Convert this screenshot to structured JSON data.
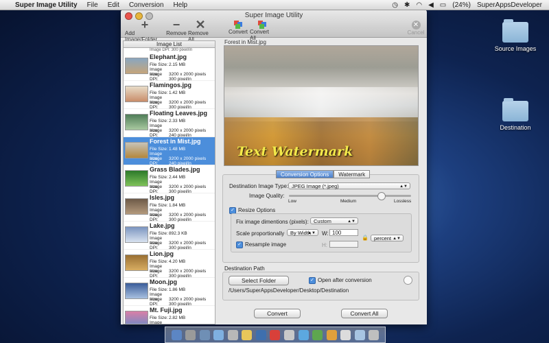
{
  "menubar": {
    "app_name": "Super Image Utility",
    "menus": [
      "File",
      "Edit",
      "Conversion",
      "Help"
    ],
    "battery": "(24%)",
    "user": "SuperAppsDeveloper"
  },
  "desktop": {
    "icons": [
      {
        "label": "Source Images"
      },
      {
        "label": "Destination"
      }
    ]
  },
  "window": {
    "title": "Super Image Utility",
    "toolbar": {
      "add": "Add Image/Folder",
      "remove": "Remove",
      "remove_all": "Remove All",
      "convert": "Convert",
      "convert_all": "Convert All",
      "cancel": "Cancel"
    },
    "image_list": {
      "header": "Image List",
      "partial_row": "Image DPI:   300 pixel/in",
      "labels": {
        "size": "File Size:",
        "dims": "Image size:",
        "dpi": "Image DPI:"
      },
      "items": [
        {
          "name": "Elephant.jpg",
          "size": "2.15 MB",
          "dims": "3200 x 2000 pixels",
          "dpi": "300 pixel/in",
          "colors": [
            "#8aa6c0",
            "#c5a57a"
          ]
        },
        {
          "name": "Flamingos.jpg",
          "size": "1.42 MB",
          "dims": "3200 x 2000 pixels",
          "dpi": "300 pixel/in",
          "colors": [
            "#e8dcc8",
            "#c98d6a"
          ]
        },
        {
          "name": "Floating Leaves.jpg",
          "size": "2.33 MB",
          "dims": "3200 x 2000 pixels",
          "dpi": "240 pixel/in",
          "colors": [
            "#4f7d58",
            "#a9c9a0"
          ]
        },
        {
          "name": "Forest in Mist.jpg",
          "size": "1.48 MB",
          "dims": "3200 x 2000 pixels",
          "dpi": "240 pixel/in",
          "colors": [
            "#c7c3b8",
            "#b4873d"
          ]
        },
        {
          "name": "Grass Blades.jpg",
          "size": "2.44 MB",
          "dims": "3200 x 2000 pixels",
          "dpi": "300 pixel/in",
          "colors": [
            "#2d7a2a",
            "#7fc25a"
          ]
        },
        {
          "name": "Isles.jpg",
          "size": "1.84 MB",
          "dims": "3200 x 2000 pixels",
          "dpi": "300 pixel/in",
          "colors": [
            "#6d5a48",
            "#b49a7d"
          ]
        },
        {
          "name": "Lake.jpg",
          "size": "892.3 KB",
          "dims": "3200 x 2000 pixels",
          "dpi": "300 pixel/in",
          "colors": [
            "#7b95c0",
            "#d8e2ef"
          ]
        },
        {
          "name": "Lion.jpg",
          "size": "4.20 MB",
          "dims": "3200 x 2000 pixels",
          "dpi": "300 pixel/in",
          "colors": [
            "#9a7033",
            "#d8ad62"
          ]
        },
        {
          "name": "Moon.jpg",
          "size": "1.86 MB",
          "dims": "3200 x 2000 pixels",
          "dpi": "300 pixel/in",
          "colors": [
            "#3a5d9a",
            "#a8c0e0"
          ]
        },
        {
          "name": "Mt. Fuji.jpg",
          "size": "2.82 MB",
          "dims": "3200 x 2000 pixels",
          "dpi": "72 pixel/in",
          "colors": [
            "#d97ea6",
            "#6e8bc7"
          ]
        }
      ],
      "selected_index": 3
    },
    "preview": {
      "caption": "Forest in Mist.jpg",
      "watermark_text": "Text Watermark"
    },
    "tabs": [
      "Conversion Options",
      "Watermark"
    ],
    "options": {
      "dest_type_label": "Destination Image Type:",
      "dest_type_value": "JPEG Image (*.jpeg)",
      "quality_label": "Image Quality:",
      "quality_low": "Low",
      "quality_medium": "Medium",
      "quality_lossless": "Lossless",
      "quality_level": 0.75,
      "resize_label": "Resize Options",
      "fix_label": "Fix image dimentions (pixels):",
      "fix_value": "Custom",
      "scale_label": "Scale proportionally",
      "scale_value": "By Width",
      "w_label": "W:",
      "w_value": "100",
      "h_label": "H:",
      "h_value": "",
      "unit_value": "percent",
      "resample_label": "Resample image"
    },
    "destination": {
      "section_label": "Destination Path",
      "select_folder": "Select Folder",
      "open_after": "Open after conversion",
      "path": "/Users/SuperAppsDeveloper/Desktop/Destination"
    },
    "buttons": {
      "convert": "Convert",
      "convert_all": "Convert All"
    }
  }
}
